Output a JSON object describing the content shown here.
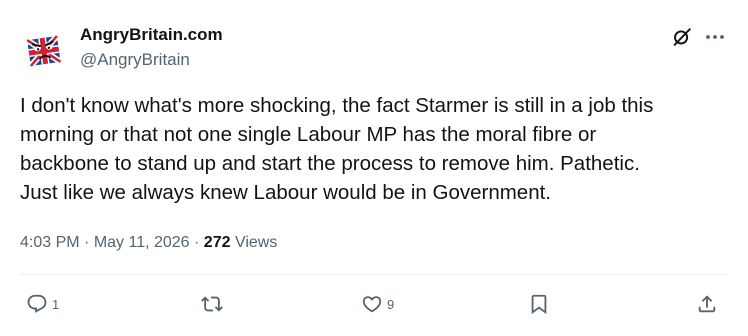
{
  "author": {
    "display_name": "AngryBritain.com",
    "handle": "@AngryBritain",
    "avatar_icon": "union-jack-angry-face-icon"
  },
  "tweet": {
    "text": "I don't know what's more shocking, the fact Starmer is still in a job this\nmorning or that not one single Labour MP has the moral fibre or\nbackbone to stand up and start the process to remove him. Pathetic.\nJust like we always knew Labour would be in Government."
  },
  "meta": {
    "time": "4:03 PM",
    "sep1": " · ",
    "date": "May 11, 2026",
    "sep2": " · ",
    "views_count": "272",
    "views_label": " Views"
  },
  "actions": {
    "reply_count": "1",
    "retweet_count": "",
    "like_count": "9",
    "reply_icon": "reply-icon",
    "retweet_icon": "retweet-icon",
    "like_icon": "heart-icon",
    "bookmark_icon": "bookmark-icon",
    "share_icon": "share-icon"
  },
  "colors": {
    "text_primary": "#0f1419",
    "text_secondary": "#536471",
    "divider": "#eff3f4"
  }
}
